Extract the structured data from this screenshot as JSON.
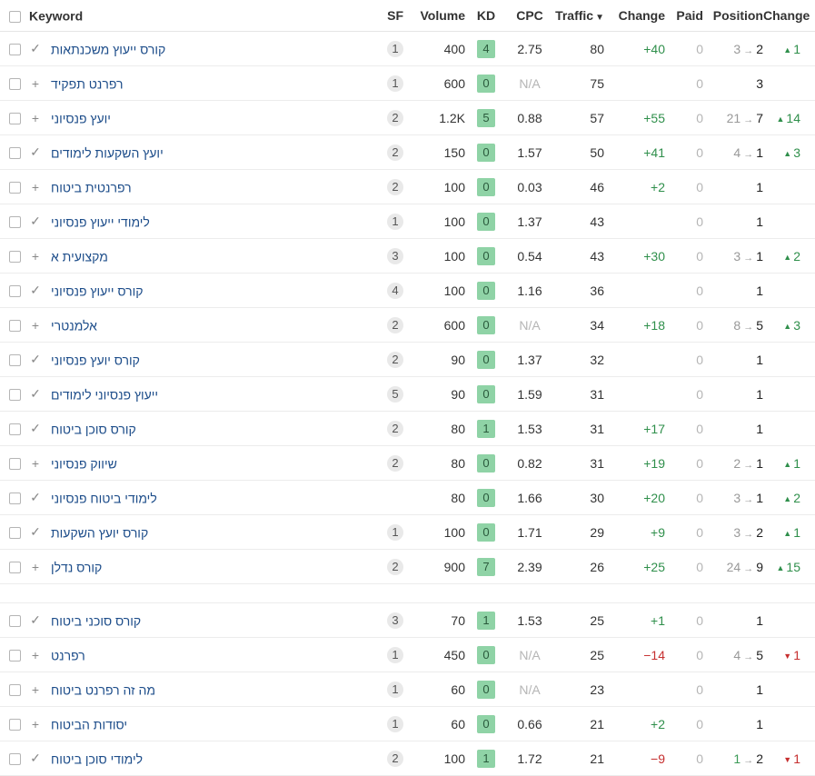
{
  "headers": {
    "keyword": "Keyword",
    "sf": "SF",
    "volume": "Volume",
    "kd": "KD",
    "cpc": "CPC",
    "traffic": "Traffic",
    "traffic_change": "Change",
    "paid": "Paid",
    "position": "Position",
    "position_change": "Change"
  },
  "rows": [
    {
      "kw": "קורס ייעוץ משכנתאות",
      "action": "check",
      "sf": "1",
      "volume": "400",
      "kd": "4",
      "cpc": "2.75",
      "traffic": "80",
      "tchange": "+40",
      "paid": "0",
      "pos_from": "3",
      "pos": "2",
      "pchange": "1",
      "pdir": "up"
    },
    {
      "kw": "רפרנט תפקיד",
      "action": "plus",
      "sf": "1",
      "volume": "600",
      "kd": "0",
      "cpc": "N/A",
      "traffic": "75",
      "tchange": "",
      "paid": "0",
      "pos_from": "",
      "pos": "3",
      "pchange": "",
      "pdir": ""
    },
    {
      "kw": "יועץ פנסיוני",
      "action": "plus",
      "sf": "2",
      "volume": "1.2K",
      "kd": "5",
      "cpc": "0.88",
      "traffic": "57",
      "tchange": "+55",
      "paid": "0",
      "pos_from": "21",
      "pos": "7",
      "pchange": "14",
      "pdir": "up"
    },
    {
      "kw": "יועץ השקעות לימודים",
      "action": "check",
      "sf": "2",
      "volume": "150",
      "kd": "0",
      "cpc": "1.57",
      "traffic": "50",
      "tchange": "+41",
      "paid": "0",
      "pos_from": "4",
      "pos": "1",
      "pchange": "3",
      "pdir": "up"
    },
    {
      "kw": "רפרנטית ביטוח",
      "action": "plus",
      "sf": "2",
      "volume": "100",
      "kd": "0",
      "cpc": "0.03",
      "traffic": "46",
      "tchange": "+2",
      "paid": "0",
      "pos_from": "",
      "pos": "1",
      "pchange": "",
      "pdir": ""
    },
    {
      "kw": "לימודי ייעוץ פנסיוני",
      "action": "check",
      "sf": "1",
      "volume": "100",
      "kd": "0",
      "cpc": "1.37",
      "traffic": "43",
      "tchange": "",
      "paid": "0",
      "pos_from": "",
      "pos": "1",
      "pchange": "",
      "pdir": ""
    },
    {
      "kw": "מקצועית א",
      "action": "plus",
      "sf": "3",
      "volume": "100",
      "kd": "0",
      "cpc": "0.54",
      "traffic": "43",
      "tchange": "+30",
      "paid": "0",
      "pos_from": "3",
      "pos": "1",
      "pchange": "2",
      "pdir": "up"
    },
    {
      "kw": "קורס ייעוץ פנסיוני",
      "action": "check",
      "sf": "4",
      "volume": "100",
      "kd": "0",
      "cpc": "1.16",
      "traffic": "36",
      "tchange": "",
      "paid": "0",
      "pos_from": "",
      "pos": "1",
      "pchange": "",
      "pdir": ""
    },
    {
      "kw": "אלמנטרי",
      "action": "plus",
      "sf": "2",
      "volume": "600",
      "kd": "0",
      "cpc": "N/A",
      "traffic": "34",
      "tchange": "+18",
      "paid": "0",
      "pos_from": "8",
      "pos": "5",
      "pchange": "3",
      "pdir": "up"
    },
    {
      "kw": "קורס יועץ פנסיוני",
      "action": "check",
      "sf": "2",
      "volume": "90",
      "kd": "0",
      "cpc": "1.37",
      "traffic": "32",
      "tchange": "",
      "paid": "0",
      "pos_from": "",
      "pos": "1",
      "pchange": "",
      "pdir": ""
    },
    {
      "kw": "ייעוץ פנסיוני לימודים",
      "action": "check",
      "sf": "5",
      "volume": "90",
      "kd": "0",
      "cpc": "1.59",
      "traffic": "31",
      "tchange": "",
      "paid": "0",
      "pos_from": "",
      "pos": "1",
      "pchange": "",
      "pdir": ""
    },
    {
      "kw": "קורס סוכן ביטוח",
      "action": "check",
      "sf": "2",
      "volume": "80",
      "kd": "1",
      "cpc": "1.53",
      "traffic": "31",
      "tchange": "+17",
      "paid": "0",
      "pos_from": "",
      "pos": "1",
      "pchange": "",
      "pdir": ""
    },
    {
      "kw": "שיווק פנסיוני",
      "action": "plus",
      "sf": "2",
      "volume": "80",
      "kd": "0",
      "cpc": "0.82",
      "traffic": "31",
      "tchange": "+19",
      "paid": "0",
      "pos_from": "2",
      "pos": "1",
      "pchange": "1",
      "pdir": "up"
    },
    {
      "kw": "לימודי ביטוח פנסיוני",
      "action": "check",
      "sf": "",
      "volume": "80",
      "kd": "0",
      "cpc": "1.66",
      "traffic": "30",
      "tchange": "+20",
      "paid": "0",
      "pos_from": "3",
      "pos": "1",
      "pchange": "2",
      "pdir": "up"
    },
    {
      "kw": "קורס יועץ השקעות",
      "action": "check",
      "sf": "1",
      "volume": "100",
      "kd": "0",
      "cpc": "1.71",
      "traffic": "29",
      "tchange": "+9",
      "paid": "0",
      "pos_from": "3",
      "pos": "2",
      "pchange": "1",
      "pdir": "up"
    },
    {
      "kw": "קורס נדלן",
      "action": "plus",
      "sf": "2",
      "volume": "900",
      "kd": "7",
      "cpc": "2.39",
      "traffic": "26",
      "tchange": "+25",
      "paid": "0",
      "pos_from": "24",
      "pos": "9",
      "pchange": "15",
      "pdir": "up"
    },
    {
      "spacer": true
    },
    {
      "kw": "קורס סוכני ביטוח",
      "action": "check",
      "sf": "3",
      "volume": "70",
      "kd": "1",
      "cpc": "1.53",
      "traffic": "25",
      "tchange": "+1",
      "paid": "0",
      "pos_from": "",
      "pos": "1",
      "pchange": "",
      "pdir": ""
    },
    {
      "kw": "רפרנט",
      "action": "plus",
      "sf": "1",
      "volume": "450",
      "kd": "0",
      "cpc": "N/A",
      "traffic": "25",
      "tchange": "−14",
      "paid": "0",
      "pos_from": "4",
      "pos": "5",
      "pchange": "1",
      "pdir": "down"
    },
    {
      "kw": "מה זה רפרנט ביטוח",
      "action": "plus",
      "sf": "1",
      "volume": "60",
      "kd": "0",
      "cpc": "N/A",
      "traffic": "23",
      "tchange": "",
      "paid": "0",
      "pos_from": "",
      "pos": "1",
      "pchange": "",
      "pdir": ""
    },
    {
      "kw": "יסודות הביטוח",
      "action": "plus",
      "sf": "1",
      "volume": "60",
      "kd": "0",
      "cpc": "0.66",
      "traffic": "21",
      "tchange": "+2",
      "paid": "0",
      "pos_from": "",
      "pos": "1",
      "pchange": "",
      "pdir": ""
    },
    {
      "kw": "לימודי סוכן ביטוח",
      "action": "check",
      "sf": "2",
      "volume": "100",
      "kd": "1",
      "cpc": "1.72",
      "traffic": "21",
      "tchange": "−9",
      "paid": "0",
      "pos_from": "1",
      "pos": "2",
      "pchange": "1",
      "pdir": "down",
      "from_color": "green"
    }
  ],
  "colors": {
    "kd_badge": "#8fd3a6",
    "keyword_link": "#1d4d8a",
    "up": "#2f8f4b",
    "down": "#c62f2f"
  }
}
